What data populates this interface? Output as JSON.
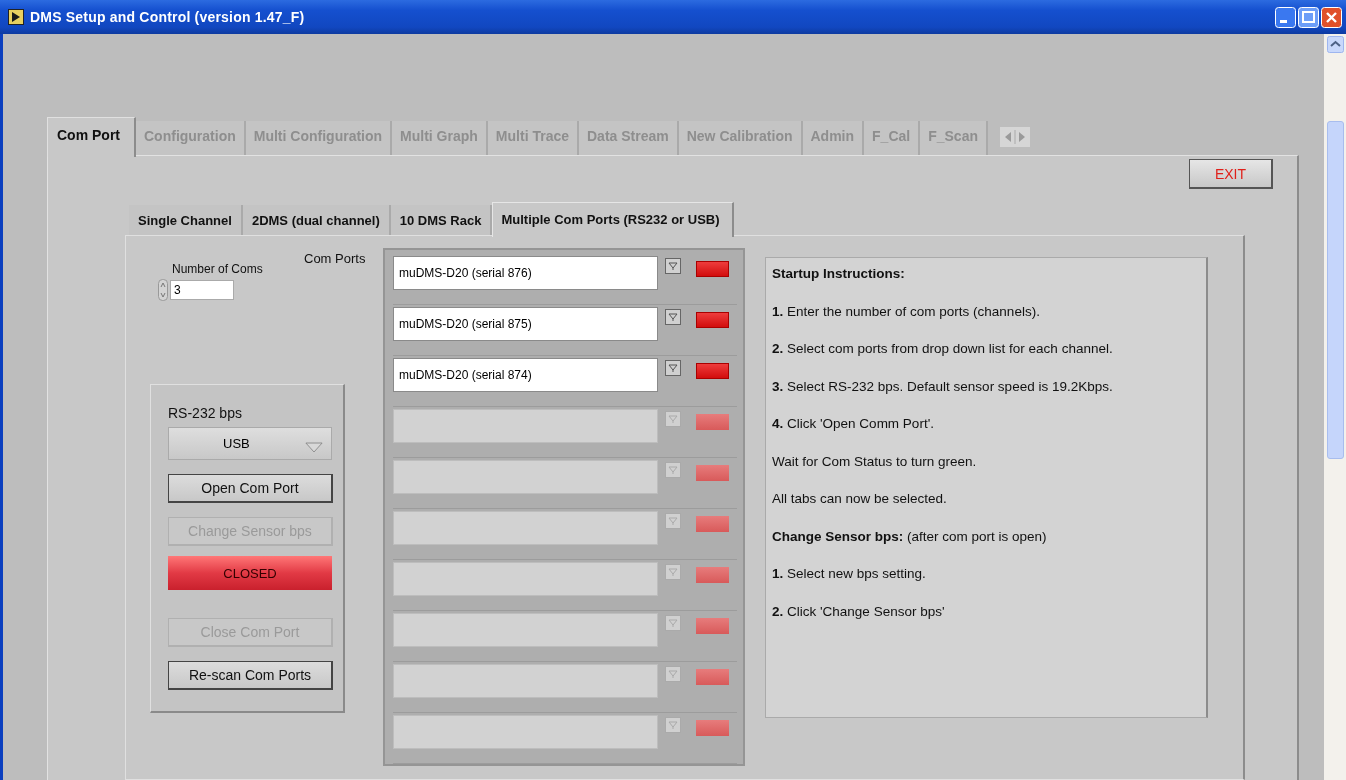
{
  "window": {
    "title": "DMS Setup and Control (version 1.47_F)"
  },
  "tabs": [
    {
      "label": "Com Port",
      "selected": true,
      "disabled": false
    },
    {
      "label": "Configuration",
      "selected": false,
      "disabled": true
    },
    {
      "label": "Multi Configuration",
      "selected": false,
      "disabled": true
    },
    {
      "label": "Multi Graph",
      "selected": false,
      "disabled": true
    },
    {
      "label": "Multi Trace",
      "selected": false,
      "disabled": true
    },
    {
      "label": "Data Stream",
      "selected": false,
      "disabled": true
    },
    {
      "label": "New Calibration",
      "selected": false,
      "disabled": true
    },
    {
      "label": "Admin",
      "selected": false,
      "disabled": true
    },
    {
      "label": "F_Cal",
      "selected": false,
      "disabled": true
    },
    {
      "label": "F_Scan",
      "selected": false,
      "disabled": true
    }
  ],
  "exit_button": "EXIT",
  "subtabs": [
    {
      "label": "Single Channel",
      "selected": false
    },
    {
      "label": "2DMS (dual channel)",
      "selected": false
    },
    {
      "label": "10 DMS Rack",
      "selected": false
    },
    {
      "label": "Multiple Com Ports (RS232 or USB)",
      "selected": true
    }
  ],
  "number_of_coms": {
    "label": "Number of Coms",
    "value": "3"
  },
  "com_ports": {
    "label": "Com Ports",
    "rows": [
      {
        "value": "muDMS-D20 (serial 876)",
        "disabled": false
      },
      {
        "value": "muDMS-D20 (serial 875)",
        "disabled": false
      },
      {
        "value": "muDMS-D20 (serial 874)",
        "disabled": false
      },
      {
        "disabled": true
      },
      {
        "disabled": true
      },
      {
        "disabled": true
      },
      {
        "disabled": true
      },
      {
        "disabled": true
      },
      {
        "disabled": true
      },
      {
        "disabled": true
      }
    ]
  },
  "bps": {
    "label": "RS-232 bps",
    "value": "USB"
  },
  "buttons": [
    {
      "label": "Open Com Port",
      "disabled": false
    },
    {
      "label": "Change Sensor bps",
      "disabled": true
    }
  ],
  "status": {
    "label": "CLOSED",
    "on": false
  },
  "buttons_lower": [
    {
      "label": "Close Com Port",
      "disabled": true
    },
    {
      "label": "Re-scan Com Ports",
      "disabled": false
    }
  ],
  "instructions": [
    "**Startup Instructions:**",
    "**1.** Enter the number of com ports (channels).",
    "**2.** Select com ports from drop down list for each channel.",
    "**3.** Select RS-232 bps.  Default sensor speed is 19.2Kbps.",
    "**4.** Click 'Open Comm Port'.",
    "Wait for Com Status to turn green.",
    "All tabs can now be selected.",
    "**Change Sensor bps:** (after com port is open)",
    "**1.** Select new bps setting.",
    "**2.** Click 'Change Sensor bps'"
  ]
}
